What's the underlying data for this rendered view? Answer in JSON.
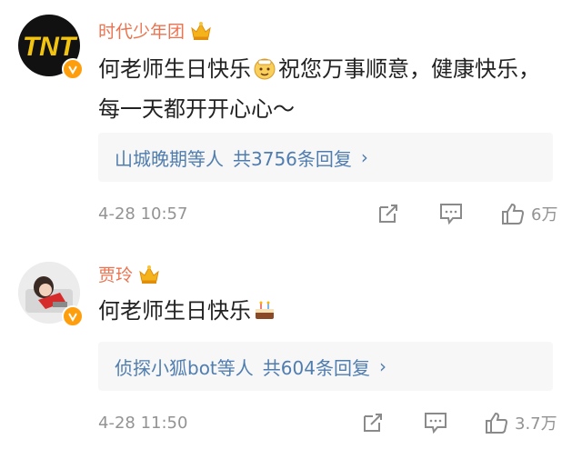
{
  "comments": [
    {
      "username": "时代少年团",
      "avatar_text": "TNT",
      "text_before_emoji": "何老师生日快乐",
      "emoji": "cake-face-emoji",
      "text_after_emoji": "祝您万事顺意，健康快乐，每一天都开开心心～",
      "reply_users": "山城晚期等人",
      "reply_count": "共3756条回复",
      "timestamp": "4-28 10:57",
      "likes": "6万"
    },
    {
      "username": "贾玲",
      "text_before_emoji": "何老师生日快乐",
      "emoji": "birthday-cake-emoji",
      "text_after_emoji": "",
      "reply_users": "侦探小狐bot等人",
      "reply_count": "共604条回复",
      "timestamp": "4-28 11:50",
      "likes": "3.7万"
    }
  ],
  "colors": {
    "username": "#eb7350",
    "link": "#507daf",
    "meta": "#939393",
    "badge": "#ff9e0d"
  }
}
